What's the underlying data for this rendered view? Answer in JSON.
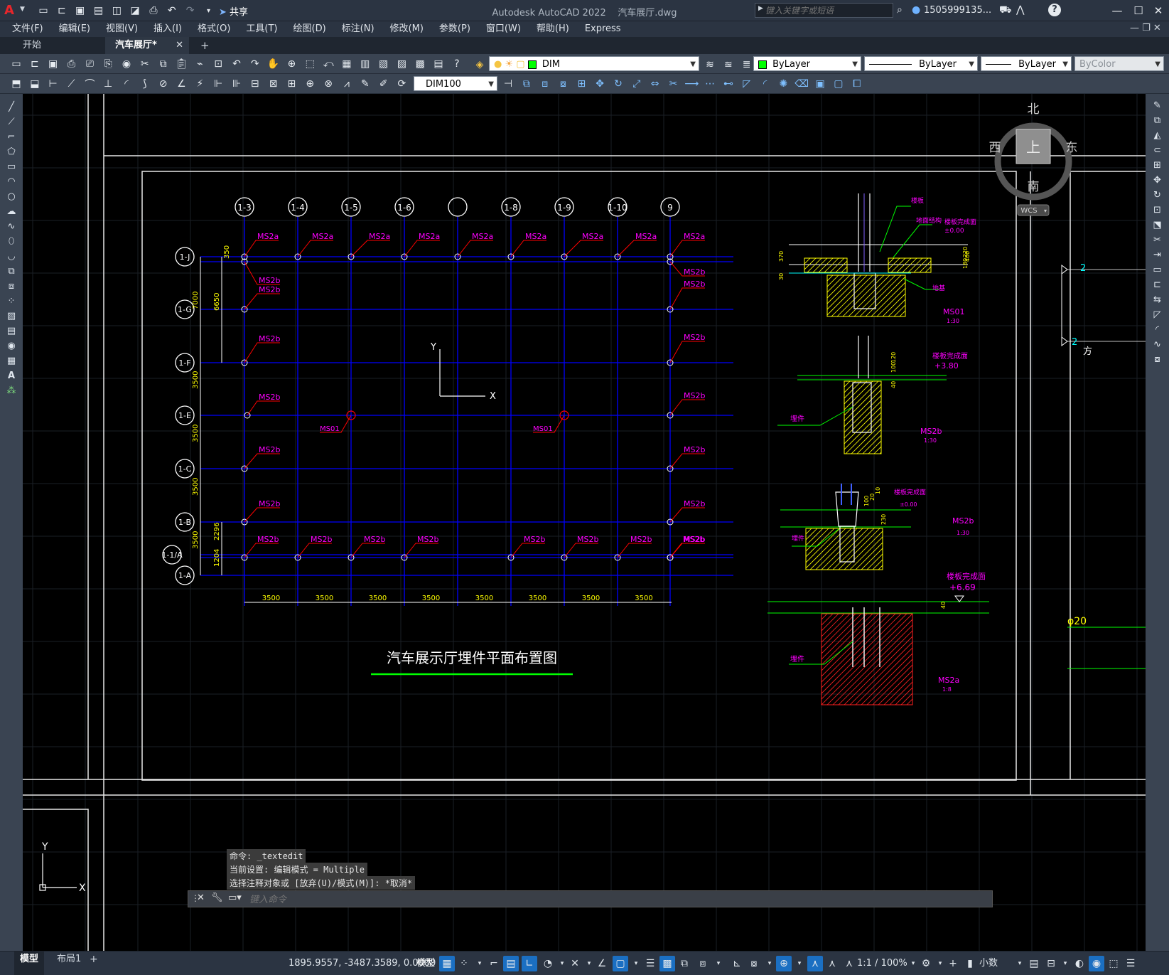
{
  "title": {
    "app_name": "Autodesk AutoCAD 2022",
    "file_name": "汽车展厅.dwg",
    "share_label": "共享",
    "search_placeholder": "键入关键字或短语",
    "user_name": "1505999135..."
  },
  "menu": [
    "文件(F)",
    "编辑(E)",
    "视图(V)",
    "插入(I)",
    "格式(O)",
    "工具(T)",
    "绘图(D)",
    "标注(N)",
    "修改(M)",
    "参数(P)",
    "窗口(W)",
    "帮助(H)",
    "Express"
  ],
  "tabs": [
    {
      "label": "开始"
    },
    {
      "label": "汽车展厅*"
    }
  ],
  "toolbar": {
    "layer_name": "DIM",
    "color": "ByLayer",
    "linetype": "ByLayer",
    "lineweight": "ByLayer",
    "plotstyle": "ByColor",
    "dim_style": "DIM100"
  },
  "viewcube": {
    "north": "北",
    "south": "南",
    "west": "西",
    "east": "东",
    "top": "上",
    "wcs": "WCS"
  },
  "drawing": {
    "title": "汽车展示厅埋件平面布置图",
    "col_labels": [
      "1-3",
      "1-4",
      "1-5",
      "1-6",
      "",
      "1-8",
      "1-9",
      "1-10",
      "9"
    ],
    "row_labels": [
      "1-J",
      "1-G",
      "1-F",
      "1-E",
      "1-C",
      "1-B",
      "1-1/A",
      "1-A"
    ],
    "bottom_dims": [
      "3500",
      "3500",
      "3500",
      "3500",
      "3500",
      "3500",
      "3500",
      "3500"
    ],
    "left_dims": [
      "350",
      "7000",
      "6650",
      "3500",
      "3500",
      "3500",
      "3500",
      "2296",
      "1204"
    ],
    "top_tags": [
      "MS2a",
      "MS2a",
      "MS2a",
      "MS2a",
      "MS2a",
      "MS2a",
      "MS2a",
      "MS2a",
      "MS2a"
    ],
    "bottom_tags": [
      "MS2b",
      "MS2b",
      "MS2b",
      "MS2b",
      "MS2b",
      "MS2b",
      "MS2b",
      "MS2b",
      "MS2b"
    ],
    "left_tags": [
      "MS2b",
      "MS2b",
      "MS2b",
      "MS2b",
      "MS2b",
      "MS2b"
    ],
    "right_tags": [
      "MS2b",
      "MS2b",
      "MS2b",
      "MS2b",
      "MS2b",
      "MS2b",
      "MS2b"
    ],
    "ms01_label": "MS01",
    "ucs_x": "X",
    "ucs_y": "Y",
    "details": {
      "d1": {
        "label_top": "楼板",
        "label_struct": "地面结构",
        "label_finish": "楼板完成面",
        "level": "±0.00",
        "dim1": "370",
        "dim2": "220",
        "dim3": "400",
        "dim4": "180",
        "dim5": "30",
        "label_base": "地基",
        "name": "MS01",
        "scale": "1:30"
      },
      "d2": {
        "label_finish": "楼板完成面",
        "level": "+3.80",
        "dim1": "120",
        "dim2": "100",
        "dim3": "40",
        "label_part": "埋件",
        "name": "MS2b",
        "scale": "1:30"
      },
      "d3": {
        "label_finish": "楼板完成面",
        "level": "±0.00",
        "dim1": "10",
        "dim2": "100",
        "dim3": "20",
        "dim4": "230",
        "label_part": "埋件",
        "name": "MS2b",
        "scale": "1:30"
      },
      "d4": {
        "label_finish": "楼板完成面",
        "level": "+6.69",
        "dim1": "40",
        "label_part": "埋件",
        "name": "MS2a",
        "scale": "1:8"
      }
    },
    "right_partial": {
      "n1": "2",
      "n2": "2",
      "phi": "φ20",
      "frag": "方"
    }
  },
  "command": {
    "history": [
      "命令: _textedit",
      "当前设置: 编辑模式 = Multiple",
      "选择注释对象或 [放弃(U)/模式(M)]: *取消*"
    ],
    "placeholder": "键入命令"
  },
  "layout_tabs": [
    "模型",
    "布局1"
  ],
  "status": {
    "coords": "1895.9557, -3487.3589, 0.0000",
    "space": "模型",
    "scale": "1:1 / 100%",
    "units": "小数"
  },
  "colors": {
    "grid_line": "#0000ff",
    "annotation": "#ff00ff",
    "leader": "#ff0000",
    "ground": "#00ff00",
    "hatch": "#ffff00",
    "background": "#000000",
    "panel": "#3a4452"
  }
}
